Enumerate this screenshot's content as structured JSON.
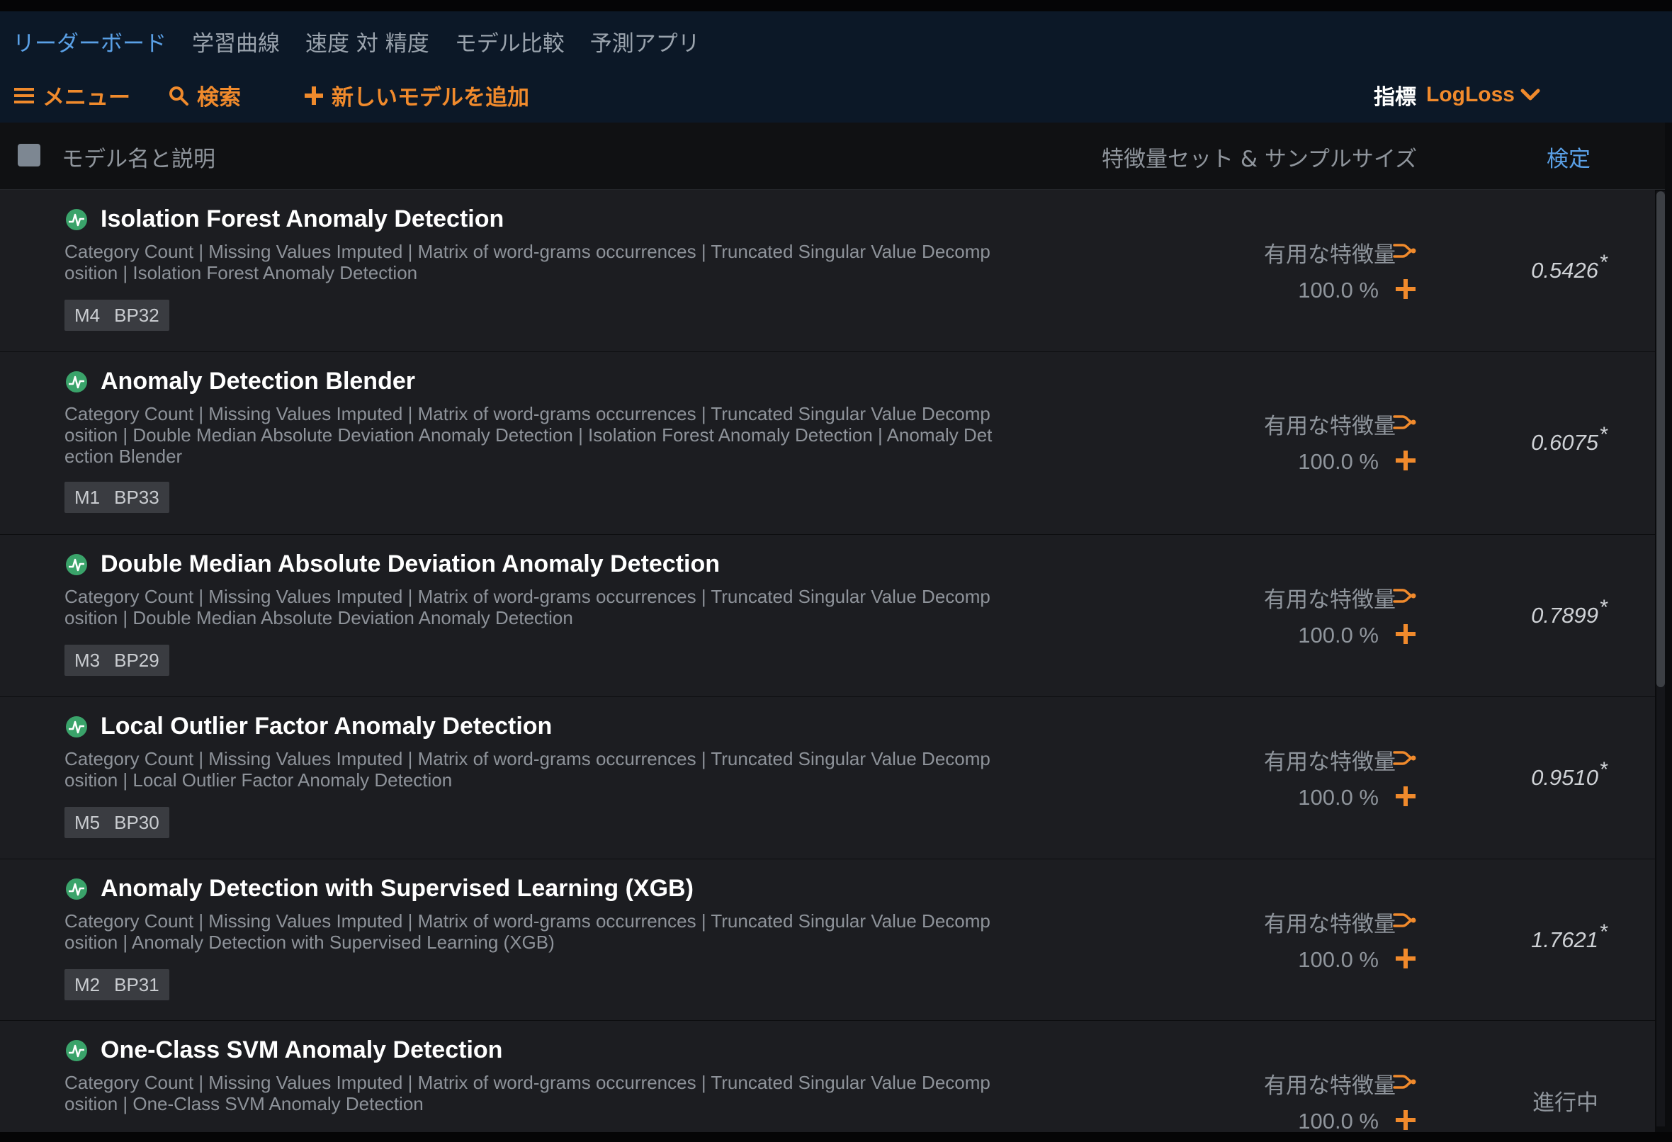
{
  "nav": {
    "tabs": [
      {
        "label": "リーダーボード",
        "active": true
      },
      {
        "label": "学習曲線",
        "active": false
      },
      {
        "label": "速度 対 精度",
        "active": false
      },
      {
        "label": "モデル比較",
        "active": false
      },
      {
        "label": "予測アプリ",
        "active": false
      }
    ]
  },
  "toolbar": {
    "menu_label": "メニュー",
    "search_label": "検索",
    "add_model_label": "新しいモデルを追加",
    "metric_label": "指標",
    "metric_value": "LogLoss"
  },
  "table": {
    "headers": {
      "name": "モデル名と説明",
      "features": "特徴量セット & サンプルサイズ",
      "validation": "検定"
    },
    "rows": [
      {
        "title": "Isolation Forest Anomaly Detection",
        "description": "Category Count | Missing Values Imputed | Matrix of word-grams occurrences | Truncated Singular Value Decomposition | Isolation Forest Anomaly Detection",
        "tags": [
          "M4",
          "BP32"
        ],
        "feature_set": "有用な特徴量",
        "sample": "100.0 %",
        "score": "0.5426",
        "star": "*"
      },
      {
        "title": "Anomaly Detection Blender",
        "description": "Category Count | Missing Values Imputed | Matrix of word-grams occurrences | Truncated Singular Value Decomposition | Double Median Absolute Deviation Anomaly Detection | Isolation Forest Anomaly Detection | Anomaly Detection Blender",
        "tags": [
          "M1",
          "BP33"
        ],
        "feature_set": "有用な特徴量",
        "sample": "100.0 %",
        "score": "0.6075",
        "star": "*"
      },
      {
        "title": "Double Median Absolute Deviation Anomaly Detection",
        "description": "Category Count | Missing Values Imputed | Matrix of word-grams occurrences | Truncated Singular Value Decomposition | Double Median Absolute Deviation Anomaly Detection",
        "tags": [
          "M3",
          "BP29"
        ],
        "feature_set": "有用な特徴量",
        "sample": "100.0 %",
        "score": "0.7899",
        "star": "*"
      },
      {
        "title": "Local Outlier Factor Anomaly Detection",
        "description": "Category Count | Missing Values Imputed | Matrix of word-grams occurrences | Truncated Singular Value Decomposition | Local Outlier Factor Anomaly Detection",
        "tags": [
          "M5",
          "BP30"
        ],
        "feature_set": "有用な特徴量",
        "sample": "100.0 %",
        "score": "0.9510",
        "star": "*"
      },
      {
        "title": "Anomaly Detection with Supervised Learning (XGB)",
        "description": "Category Count | Missing Values Imputed | Matrix of word-grams occurrences | Truncated Singular Value Decomposition | Anomaly Detection with Supervised Learning (XGB)",
        "tags": [
          "M2",
          "BP31"
        ],
        "feature_set": "有用な特徴量",
        "sample": "100.0 %",
        "score": "1.7621",
        "star": "*"
      },
      {
        "title": "One-Class SVM Anomaly Detection",
        "description": "Category Count | Missing Values Imputed | Matrix of word-grams occurrences | Truncated Singular Value Decomposition | One-Class SVM Anomaly Detection",
        "feature_set": "有用な特徴量",
        "sample": "100.0 %",
        "status": "進行中"
      }
    ]
  },
  "colors": {
    "accent_orange": "#f08a2c",
    "link_blue": "#5aa0e6",
    "header_bg": "#0c1827",
    "row_bg": "#1c1d21",
    "model_icon_green": "#3aa36a"
  },
  "icons": {
    "menu": "hamburger-icon",
    "search": "search-icon",
    "add": "plus-icon",
    "metric_dropdown": "chevron-down-icon",
    "model": "anomaly-model-icon",
    "feature_set": "feature-branch-icon",
    "sample_add": "plus-icon"
  }
}
